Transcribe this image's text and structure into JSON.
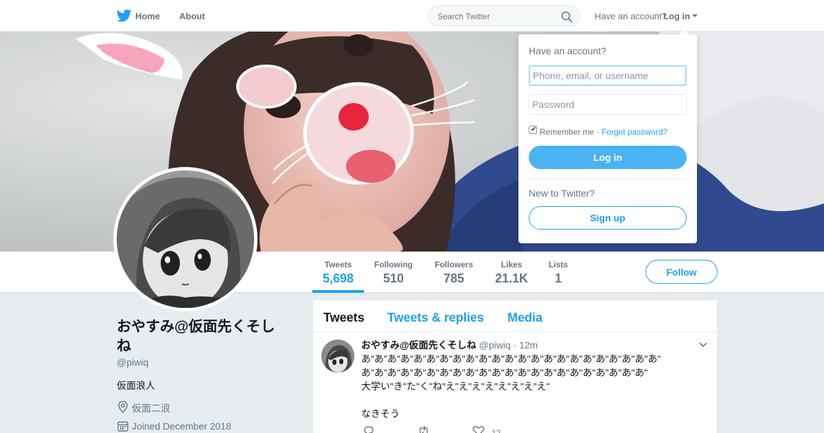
{
  "nav": {
    "logo_icon": "twitter-bird-icon",
    "home_label": "Home",
    "about_label": "About",
    "search_placeholder": "Search Twitter",
    "search_icon": "search-icon",
    "have_account": "Have an account?",
    "login_label": "Log in"
  },
  "colors": {
    "accent": "#1da1f2",
    "button_fill": "#4ab3f4",
    "background": "#e6ecf0"
  },
  "stats": [
    {
      "label": "Tweets",
      "value": "5,698",
      "active": true
    },
    {
      "label": "Following",
      "value": "510"
    },
    {
      "label": "Followers",
      "value": "785"
    },
    {
      "label": "Likes",
      "value": "21.1K"
    },
    {
      "label": "Lists",
      "value": "1"
    }
  ],
  "profile": {
    "follow_label": "Follow",
    "display_name": "おやすみ@仮面先くそしね",
    "handle": "@piwiq",
    "bio": "仮面浪人",
    "location": "仮面二浪",
    "joined": "Joined December 2018"
  },
  "timeline": {
    "tabs": [
      "Tweets",
      "Tweets & replies",
      "Media"
    ],
    "active_tab": "Tweets"
  },
  "tweet": {
    "name": "おやすみ@仮面先くそしね",
    "handle": "@piwiq",
    "time": "· 12m",
    "text": "あ\"あ\"あ\"あ\"あ\"あ\"あ\"あ\"あ\"あ\"あ\"あ\"あ\"あ\"あ\"あ\"あ\"あ\"あ\"あ\"あ\"あ\"あ\"\nあ\"あ\"あ\"あ\"あ\"あ\"あ\"あ\"あ\"あ\"あ\"あ\"あ\"あ\"あ\"あ\"あ\"あ\"あ\"あ\"あ\"あ\"\n大学い\"き\"た\"く\"ね\"え\"え\"え\"え\"え\"え\"え\"え\"\n\nなきそう",
    "like_count": "12"
  },
  "login_dropdown": {
    "title": "Have an account?",
    "username_placeholder": "Phone, email, or username",
    "password_placeholder": "Password",
    "remember_label": "Remember me ·",
    "remember_checked": true,
    "forgot_label": "Forgot password?",
    "login_button": "Log in",
    "new_label": "New to Twitter?",
    "signup_button": "Sign up"
  }
}
